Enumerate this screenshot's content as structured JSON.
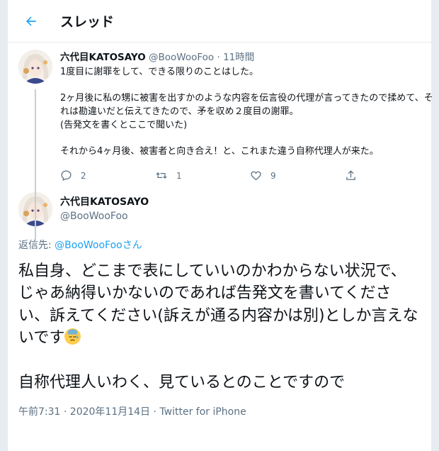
{
  "header": {
    "title": "スレッド"
  },
  "tweet1": {
    "name": "六代目KATOSAYO",
    "handle": "@BooWooFoo",
    "separator": "·",
    "time": "11時間",
    "text": "1度目に謝罪をして、できる限りのことはした。\n\n2ヶ月後に私の甥に被害を出すかのような内容を伝言役の代理が言ってきたので揉めて、それは勘違いだと伝えてきたので、矛を収め２度目の謝罪。\n(告発文を書くとここで聞いた)\n\nそれから4ヶ月後、被害者と向き合え！と、これまた違う自称代理人が来た。",
    "reply_count": "2",
    "retweet_count": "1",
    "like_count": "9"
  },
  "tweet2": {
    "name": "六代目KATOSAYO",
    "handle": "@BooWooFoo",
    "reply_prefix": "返信先: ",
    "reply_mention": "@BooWooFooさん",
    "text_main": "私自身、どこまで表にしていいのかわからない状況で、じゃあ納得いかないのであれば告発文を書いてください、訴えてください(訴えが通る内容かは別)としか言えないです",
    "text_after": "\n\n自称代理人いわく、見ているとのことですので",
    "emoji": "downcast-face-with-sweat",
    "timestamp": "午前7:31 · 2020年11月14日 · ",
    "client": "Twitter for iPhone"
  },
  "colors": {
    "accent": "#1da1f2",
    "text_primary": "#0f1419",
    "text_secondary": "#5b7083",
    "border": "#e6ecf0",
    "thread_line": "#c4cfd6"
  }
}
